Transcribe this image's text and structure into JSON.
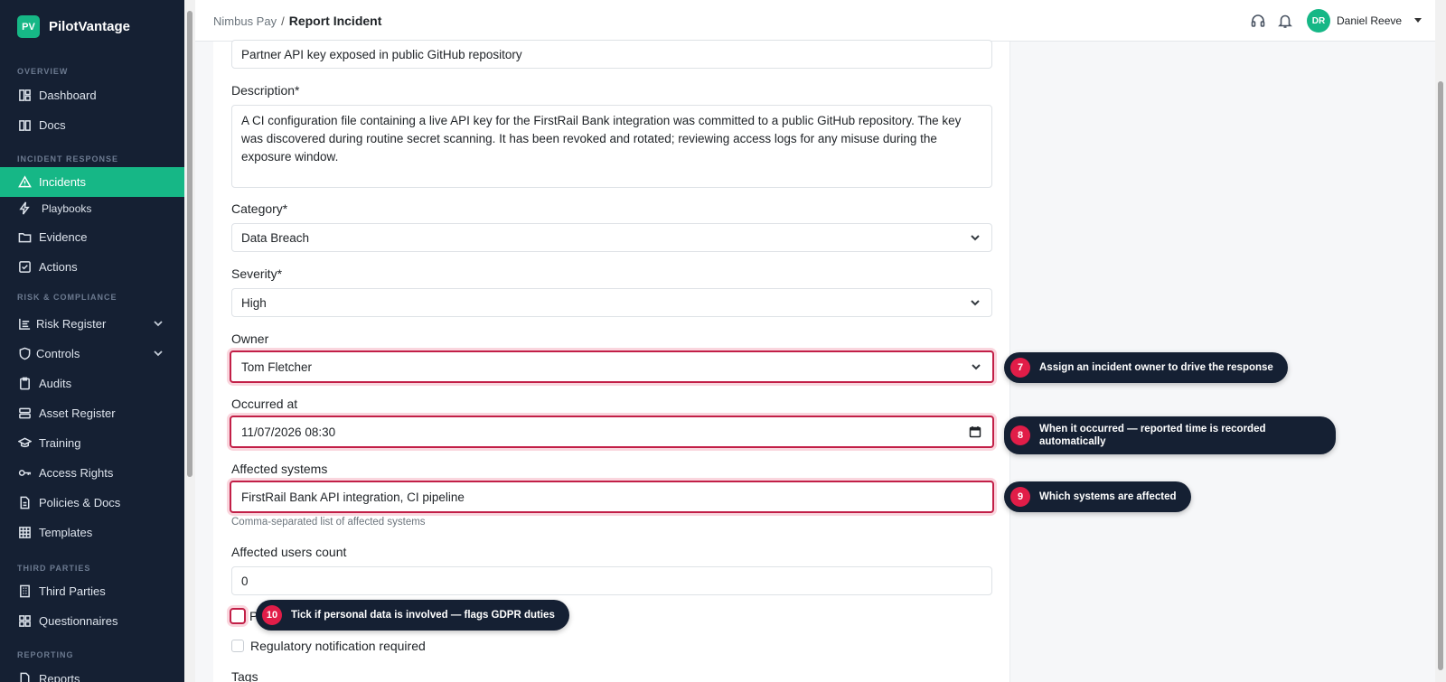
{
  "brand": {
    "mark": "PV",
    "name": "PilotVantage"
  },
  "sidebar": {
    "sections": {
      "overview": "OVERVIEW",
      "incident_response": "INCIDENT RESPONSE",
      "risk_compliance": "RISK & COMPLIANCE",
      "third_parties": "THIRD PARTIES",
      "reporting": "REPORTING"
    },
    "items": {
      "dashboard": "Dashboard",
      "docs": "Docs",
      "incidents": "Incidents",
      "playbooks": "Playbooks",
      "evidence": "Evidence",
      "actions": "Actions",
      "risk_register": "Risk Register",
      "controls": "Controls",
      "audits": "Audits",
      "asset_register": "Asset Register",
      "training": "Training",
      "access_rights": "Access Rights",
      "policies_docs": "Policies & Docs",
      "templates": "Templates",
      "third_parties": "Third Parties",
      "questionnaires": "Questionnaires",
      "reports": "Reports"
    },
    "active": "incidents"
  },
  "header": {
    "breadcrumb_parent": "Nimbus Pay",
    "breadcrumb_sep": "/",
    "breadcrumb_current": "Report Incident",
    "user_initials": "DR",
    "user_name": "Daniel Reeve"
  },
  "form": {
    "title_value": "Partner API key exposed in public GitHub repository",
    "description_label": "Description*",
    "description_value": "A CI configuration file containing a live API key for the FirstRail Bank integration was committed to a public GitHub repository. The key was discovered during routine secret scanning. It has been revoked and rotated; reviewing access logs for any misuse during the exposure window.",
    "category_label": "Category*",
    "category_value": "Data Breach",
    "severity_label": "Severity*",
    "severity_value": "High",
    "owner_label": "Owner",
    "owner_value": "Tom Fletcher",
    "occurred_label": "Occurred at",
    "occurred_value": "11/07/2026 08:30",
    "systems_label": "Affected systems",
    "systems_value": "FirstRail Bank API integration, CI pipeline",
    "systems_help": "Comma-separated list of affected systems",
    "users_label": "Affected users count",
    "users_value": "0",
    "personal_data_label_partial": "P",
    "regulatory_label": "Regulatory notification required",
    "tags_label": "Tags"
  },
  "tips": [
    {
      "num": "7",
      "pre": "Assign an ",
      "bold": "incident owner",
      "post": " to drive the response"
    },
    {
      "num": "8",
      "pre": "When it ",
      "bold": "occurred",
      "post": " — reported time is recorded automatically"
    },
    {
      "num": "9",
      "pre": "Which ",
      "bold": "systems",
      "post": " are affected"
    },
    {
      "num": "10",
      "pre": "Tick if ",
      "bold": "personal data",
      "post": " is involved — flags GDPR duties"
    }
  ],
  "colors": {
    "accent": "#16b786",
    "sidebar_bg": "#152033",
    "highlight": "#c21f47",
    "badge": "#e11d48"
  }
}
